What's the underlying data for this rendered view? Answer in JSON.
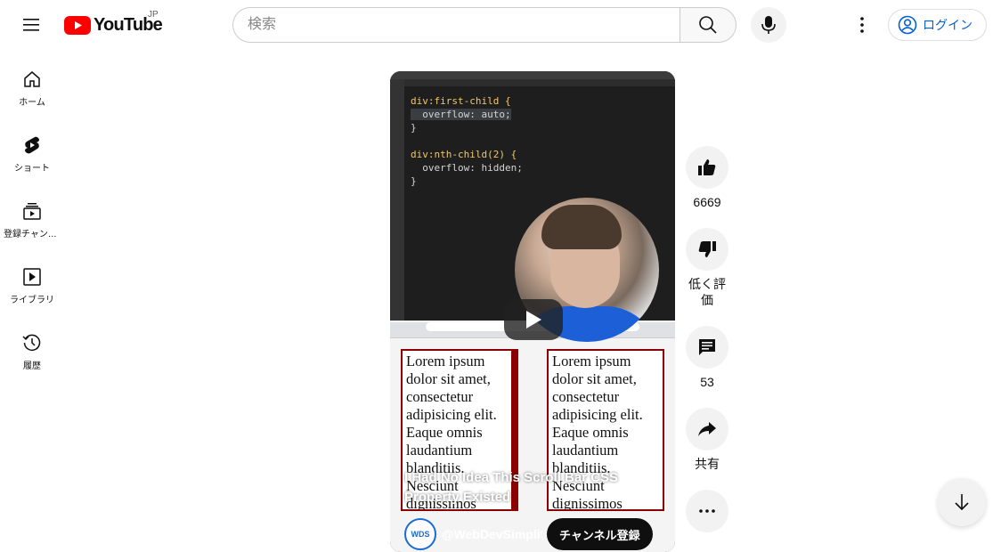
{
  "header": {
    "logo_text": "YouTube",
    "region": "JP",
    "search_placeholder": "検索",
    "login_label": "ログイン"
  },
  "sidebar": {
    "items": [
      {
        "label": "ホーム",
        "icon": "home-icon"
      },
      {
        "label": "ショート",
        "icon": "shorts-icon"
      },
      {
        "label": "登録チャンネル",
        "icon": "subscriptions-icon"
      },
      {
        "label": "ライブラリ",
        "icon": "library-icon"
      },
      {
        "label": "履歴",
        "icon": "history-icon"
      }
    ]
  },
  "video": {
    "title": "I Had No Idea This Scroll Bar CSS Property Existed",
    "channel_handle": "@WebDevSimplified",
    "channel_avatar_text": "WDS",
    "subscribe_label": "チャンネル登録",
    "code_lines": [
      [
        "div:first-child {"
      ],
      [
        "  overflow: auto;"
      ],
      [
        "}"
      ],
      [
        ""
      ],
      [
        "div:nth-child(2) {"
      ],
      [
        "  overflow: hidden;"
      ],
      [
        "}"
      ]
    ],
    "lorem_text": "Lorem ipsum dolor sit amet, consectetur adipisicing elit. Eaque omnis laudantium blanditiis. Nesciunt dignissimos"
  },
  "actions": {
    "like_count": "6669",
    "dislike_label": "低く評価",
    "comment_count": "53",
    "share_label": "共有"
  },
  "colors": {
    "brand_red": "#ff0000",
    "link_blue": "#065fd4",
    "button_bg": "#f2f2f2"
  }
}
